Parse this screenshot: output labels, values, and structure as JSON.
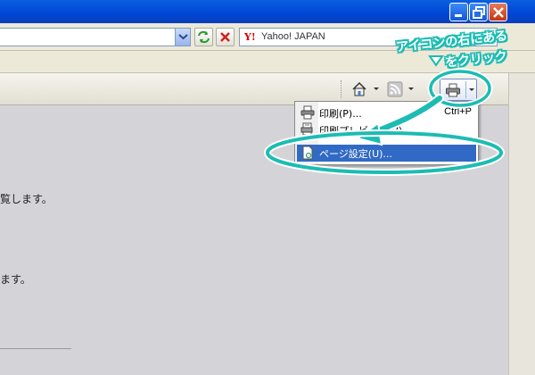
{
  "search": {
    "text": "Yahoo! JAPAN",
    "logo": "Y!"
  },
  "menu": {
    "items": [
      {
        "label": "印刷(P)...",
        "shortcut": "Ctrl+P",
        "icon": "printer-icon"
      },
      {
        "label": "印刷プレビュー(V)...",
        "shortcut": "",
        "icon": "print-preview-icon"
      },
      {
        "label": "ページ設定(U)...",
        "shortcut": "",
        "icon": "page-setup-icon"
      }
    ]
  },
  "content": {
    "line1": "覧します。",
    "line2": "ます。"
  },
  "callout": {
    "line1": "アイコンの右にある",
    "line2": "をクリック"
  },
  "colors": {
    "accent": "#1bbcb3",
    "menu_highlight": "#316ac5",
    "titlebar": "#0046d5"
  }
}
